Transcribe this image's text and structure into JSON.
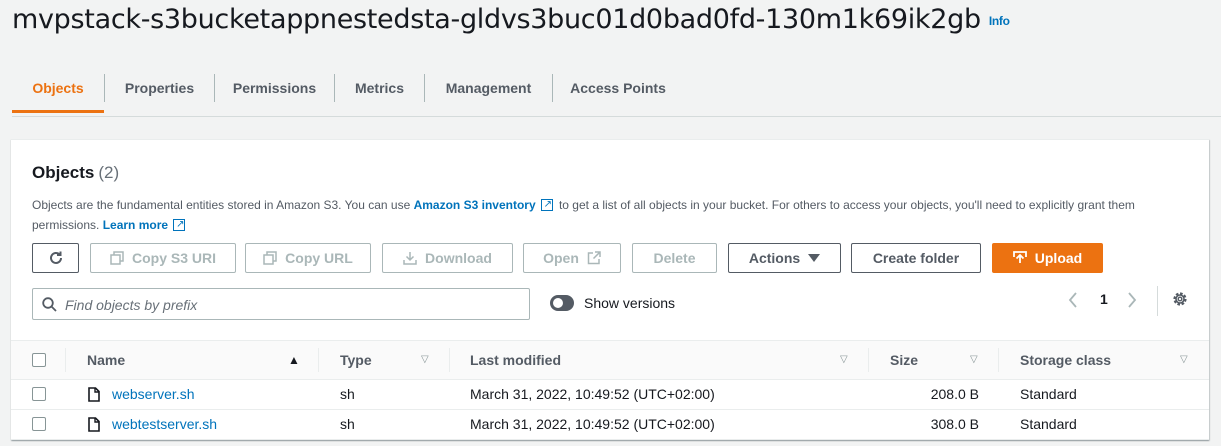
{
  "header": {
    "bucket_name": "mvpstack-s3bucketappnestedsta-gldvs3buc01d0bad0fd-130m1k69ik2gb",
    "info_label": "Info"
  },
  "tabs": [
    {
      "label": "Objects",
      "active": true
    },
    {
      "label": "Properties"
    },
    {
      "label": "Permissions"
    },
    {
      "label": "Metrics"
    },
    {
      "label": "Management"
    },
    {
      "label": "Access Points"
    }
  ],
  "objects_panel": {
    "title": "Objects",
    "count": "(2)",
    "desc_part1": "Objects are the fundamental entities stored in Amazon S3. You can use",
    "inventory_link": "Amazon S3 inventory",
    "desc_part2": "to get a list of all objects in your bucket. For others to access your objects, you'll need to explicitly grant them permissions.",
    "learn_more": "Learn more"
  },
  "toolbar": {
    "refresh_icon": "refresh-icon",
    "copy_s3_uri": "Copy S3 URI",
    "copy_url": "Copy URL",
    "download": "Download",
    "open": "Open",
    "delete": "Delete",
    "actions": "Actions",
    "create_folder": "Create folder",
    "upload": "Upload"
  },
  "search": {
    "placeholder": "Find objects by prefix",
    "value": ""
  },
  "show_versions": {
    "label": "Show versions",
    "enabled": false
  },
  "pagination": {
    "current_page": "1"
  },
  "table": {
    "columns": [
      "Name",
      "Type",
      "Last modified",
      "Size",
      "Storage class"
    ],
    "rows": [
      {
        "name": "webserver.sh",
        "type": "sh",
        "last_modified": "March 31, 2022, 10:49:52 (UTC+02:00)",
        "size": "208.0 B",
        "storage_class": "Standard"
      },
      {
        "name": "webtestserver.sh",
        "type": "sh",
        "last_modified": "March 31, 2022, 10:49:52 (UTC+02:00)",
        "size": "308.0 B",
        "storage_class": "Standard"
      }
    ]
  },
  "colors": {
    "accent": "#ec7211",
    "link": "#0073bb",
    "text": "#16191f"
  }
}
